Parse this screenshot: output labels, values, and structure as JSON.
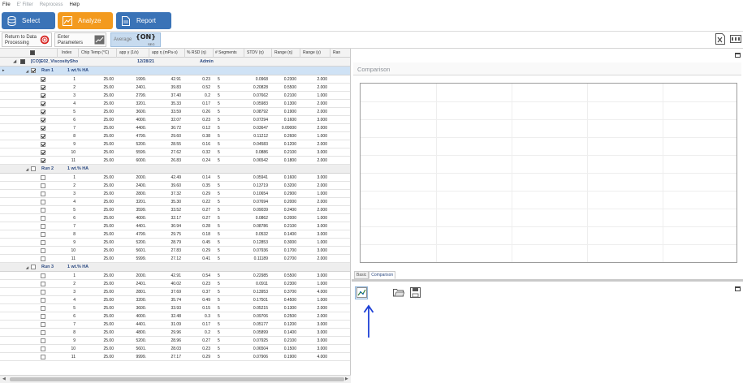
{
  "menu": [
    "File",
    "E' Filter",
    "Reprocess",
    "Help"
  ],
  "nav": {
    "select": "Select",
    "analyze": "Analyze",
    "report": "Report"
  },
  "toolbar": {
    "return_line1": "Return to Data",
    "return_line2": "Processing",
    "enter_line1": "Enter",
    "enter_line2": "Parameters",
    "average": "Average",
    "on": "{ON}",
    "on_sub": "SEG"
  },
  "grid": {
    "columns": [
      "Index",
      "Chip Temp (°C)",
      "app γ (1/s)",
      "app η (mPa·s)",
      "% RSD (η)",
      "# Segments",
      "STDV (η)",
      "Range (η)",
      "Range (γ)",
      "Ran"
    ],
    "top": {
      "name": "[CO]E02_ViscositySho",
      "date": "12/28/21",
      "user": "Admin"
    },
    "runs": [
      {
        "name": "Run 1",
        "sample": "1 wt.% HA",
        "checked": true,
        "rows": [
          [
            "1",
            "25.00",
            "1999.",
            "42.91",
            "0.23",
            "5",
            "0.0968",
            "0.2300",
            "2.000"
          ],
          [
            "2",
            "25.00",
            "2401.",
            "39.83",
            "0.52",
            "5",
            "0.20828",
            "0.5500",
            "2.000"
          ],
          [
            "3",
            "25.00",
            "2799.",
            "37.40",
            "0.2",
            "5",
            "0.07662",
            "0.2100",
            "1.000"
          ],
          [
            "4",
            "25.00",
            "3201.",
            "35.33",
            "0.17",
            "5",
            "0.05983",
            "0.1300",
            "2.000"
          ],
          [
            "5",
            "25.00",
            "3600.",
            "33.59",
            "0.26",
            "5",
            "0.08792",
            "0.1900",
            "2.000"
          ],
          [
            "6",
            "25.00",
            "4000.",
            "32.07",
            "0.23",
            "5",
            "0.07294",
            "0.1600",
            "3.000"
          ],
          [
            "7",
            "25.00",
            "4400.",
            "30.72",
            "0.12",
            "5",
            "0.03647",
            "0.09000",
            "2.000"
          ],
          [
            "8",
            "25.00",
            "4799.",
            "29.60",
            "0.38",
            "5",
            "0.11212",
            "0.2600",
            "1.000"
          ],
          [
            "9",
            "25.00",
            "5200.",
            "28.55",
            "0.16",
            "5",
            "0.04583",
            "0.1200",
            "2.000"
          ],
          [
            "10",
            "25.00",
            "5599.",
            "27.62",
            "0.32",
            "5",
            "0.0886",
            "0.2100",
            "3.000"
          ],
          [
            "11",
            "25.00",
            "6000.",
            "26.83",
            "0.24",
            "5",
            "0.06542",
            "0.1800",
            "2.000"
          ]
        ]
      },
      {
        "name": "Run 2",
        "sample": "1 wt.% HA",
        "checked": false,
        "rows": [
          [
            "1",
            "25.00",
            "2000.",
            "42.49",
            "0.14",
            "5",
            "0.05941",
            "0.1600",
            "3.000"
          ],
          [
            "2",
            "25.00",
            "2400.",
            "39.60",
            "0.35",
            "5",
            "0.13719",
            "0.3200",
            "2.000"
          ],
          [
            "3",
            "25.00",
            "2800.",
            "37.32",
            "0.29",
            "5",
            "0.10654",
            "0.2900",
            "1.000"
          ],
          [
            "4",
            "25.00",
            "3201.",
            "35.30",
            "0.22",
            "5",
            "0.07694",
            "0.2000",
            "2.000"
          ],
          [
            "5",
            "25.00",
            "3599.",
            "33.52",
            "0.27",
            "5",
            "0.09039",
            "0.2400",
            "2.000"
          ],
          [
            "6",
            "25.00",
            "4000.",
            "32.17",
            "0.27",
            "5",
            "0.0862",
            "0.2000",
            "1.000"
          ],
          [
            "7",
            "25.00",
            "4401.",
            "30.94",
            "0.28",
            "5",
            "0.08786",
            "0.2100",
            "3.000"
          ],
          [
            "8",
            "25.00",
            "4799.",
            "29.75",
            "0.18",
            "5",
            "0.0532",
            "0.1400",
            "3.000"
          ],
          [
            "9",
            "25.00",
            "5200.",
            "28.79",
            "0.45",
            "5",
            "0.12853",
            "0.3000",
            "1.000"
          ],
          [
            "10",
            "25.00",
            "5601.",
            "27.83",
            "0.29",
            "5",
            "0.07936",
            "0.1700",
            "3.000"
          ],
          [
            "11",
            "25.00",
            "5999.",
            "27.12",
            "0.41",
            "5",
            "0.11189",
            "0.2700",
            "2.000"
          ]
        ]
      },
      {
        "name": "Run 3",
        "sample": "1 wt.% HA",
        "checked": false,
        "rows": [
          [
            "1",
            "25.00",
            "2000.",
            "42.91",
            "0.54",
            "5",
            "0.22985",
            "0.5500",
            "3.000"
          ],
          [
            "2",
            "25.00",
            "2401.",
            "40.02",
            "0.23",
            "5",
            "0.0911",
            "0.2300",
            "1.000"
          ],
          [
            "3",
            "25.00",
            "2801.",
            "37.69",
            "0.37",
            "5",
            "0.13953",
            "0.3700",
            "4.000"
          ],
          [
            "4",
            "25.00",
            "3200.",
            "35.74",
            "0.49",
            "5",
            "0.17501",
            "0.4500",
            "1.000"
          ],
          [
            "5",
            "25.00",
            "3600.",
            "33.93",
            "0.15",
            "5",
            "0.05215",
            "0.1300",
            "2.000"
          ],
          [
            "6",
            "25.00",
            "4000.",
            "32.48",
            "0.3",
            "5",
            "0.09706",
            "0.2500",
            "2.000"
          ],
          [
            "7",
            "25.00",
            "4401.",
            "31.09",
            "0.17",
            "5",
            "0.05177",
            "0.1200",
            "3.000"
          ],
          [
            "8",
            "25.00",
            "4800.",
            "29.96",
            "0.2",
            "5",
            "0.05899",
            "0.1400",
            "3.000"
          ],
          [
            "9",
            "25.00",
            "5200.",
            "28.96",
            "0.27",
            "5",
            "0.07925",
            "0.2100",
            "3.000"
          ],
          [
            "10",
            "25.00",
            "5601.",
            "28.03",
            "0.23",
            "5",
            "0.06504",
            "0.1500",
            "3.000"
          ],
          [
            "11",
            "25.00",
            "9999.",
            "27.17",
            "0.29",
            "5",
            "0.07906",
            "0.1900",
            "4.000"
          ]
        ]
      }
    ]
  },
  "right": {
    "comparison_title": "Comparison",
    "tabs": [
      "Basic",
      "Comparison"
    ]
  },
  "colors": {
    "nav_blue": "#3a73b7",
    "nav_orange": "#f39a1e",
    "arrow_blue": "#1e40d6",
    "group_text": "#2c4a82"
  },
  "icons": [
    "database-icon",
    "analyze-icon",
    "report-icon",
    "return-icon",
    "parameters-icon",
    "export-excel-icon",
    "export-csv-icon",
    "chart-icon",
    "folder-open-icon",
    "save-icon",
    "pin-icon"
  ]
}
